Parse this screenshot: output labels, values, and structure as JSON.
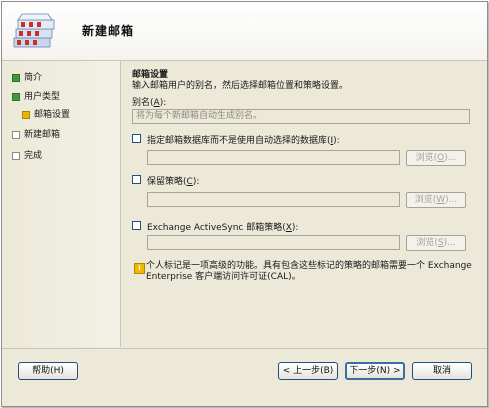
{
  "wizard": {
    "title": "新建邮箱"
  },
  "nav": {
    "items": [
      {
        "label": "简介",
        "state": "done"
      },
      {
        "label": "用户类型",
        "state": "done"
      },
      {
        "label": "邮箱设置",
        "state": "current"
      },
      {
        "label": "新建邮箱",
        "state": "todo"
      },
      {
        "label": "完成",
        "state": "todo"
      }
    ]
  },
  "content": {
    "section_title": "邮箱设置",
    "section_desc": "输入邮箱用户的别名，然后选择邮箱位置和策略设置。",
    "alias": {
      "label_prefix": "别名(",
      "label_key": "A",
      "label_suffix": "):",
      "placeholder": "将为每个新邮箱自动生成别名。"
    },
    "database": {
      "label_prefix": "指定邮箱数据库而不是使用自动选择的数据库(",
      "label_key": "I",
      "label_suffix": "):",
      "browse": "浏览(",
      "browse_key": "O",
      "browse_suffix": ")..."
    },
    "retention": {
      "label_prefix": "保留策略(",
      "label_key": "C",
      "label_suffix": "):",
      "browse": "浏览(",
      "browse_key": "W",
      "browse_suffix": ")..."
    },
    "activesync": {
      "label_prefix": "Exchange ActiveSync 邮箱策略(",
      "label_key": "X",
      "label_suffix": "):",
      "browse": "浏览(",
      "browse_key": "S",
      "browse_suffix": ")..."
    },
    "info_text": "个人标记是一项高级的功能。具有包含这些标记的策略的邮箱需要一个 Exchange Enterprise 客户端访问许可证(CAL)。"
  },
  "footer": {
    "help": "帮助(H)",
    "back": "< 上一步(B)",
    "next": "下一步(N) >",
    "cancel": "取消"
  },
  "colors": {
    "dialog_bg": "#ece9d8",
    "done": "#3e9a3a",
    "current": "#e6b800",
    "button_border": "#1f4f7a"
  }
}
